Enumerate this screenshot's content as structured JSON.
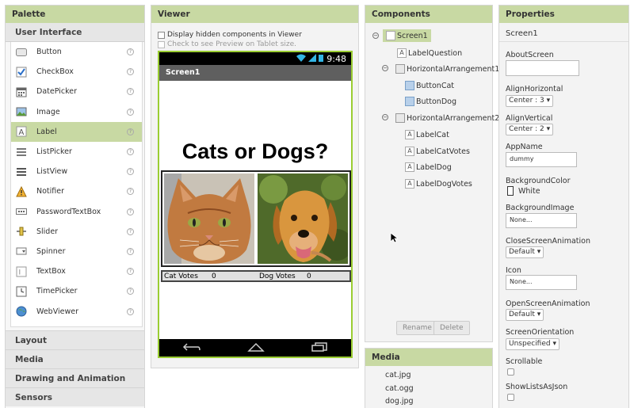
{
  "palette": {
    "title": "Palette",
    "category": "User Interface",
    "items": [
      {
        "label": "Button",
        "icon": "button-icon"
      },
      {
        "label": "CheckBox",
        "icon": "checkbox-icon"
      },
      {
        "label": "DatePicker",
        "icon": "calendar-icon"
      },
      {
        "label": "Image",
        "icon": "image-icon"
      },
      {
        "label": "Label",
        "icon": "label-icon"
      },
      {
        "label": "ListPicker",
        "icon": "listpicker-icon"
      },
      {
        "label": "ListView",
        "icon": "listview-icon"
      },
      {
        "label": "Notifier",
        "icon": "warning-icon"
      },
      {
        "label": "PasswordTextBox",
        "icon": "password-icon"
      },
      {
        "label": "Slider",
        "icon": "slider-icon"
      },
      {
        "label": "Spinner",
        "icon": "spinner-icon"
      },
      {
        "label": "TextBox",
        "icon": "textbox-icon"
      },
      {
        "label": "TimePicker",
        "icon": "clock-icon"
      },
      {
        "label": "WebViewer",
        "icon": "globe-icon"
      }
    ],
    "help_glyph": "?",
    "other_categories": [
      "Layout",
      "Media",
      "Drawing and Animation",
      "Sensors"
    ]
  },
  "viewer": {
    "title": "Viewer",
    "show_hidden": "Display hidden components in Viewer",
    "tablet_preview": "Check to see Preview on Tablet size.",
    "phone": {
      "time": "9:48",
      "screen_title": "Screen1",
      "question": "Cats or Dogs?",
      "cat_votes_label": "Cat Votes",
      "cat_votes": "0",
      "dog_votes_label": "Dog Votes",
      "dog_votes": "0"
    }
  },
  "components": {
    "title": "Components",
    "tree": [
      {
        "label": "Screen1",
        "icon": "screen-icon"
      },
      {
        "label": "LabelQuestion",
        "icon": "label-icon"
      },
      {
        "label": "HorizontalArrangement1",
        "icon": "arrangement-icon"
      },
      {
        "label": "ButtonCat",
        "icon": "button-icon"
      },
      {
        "label": "ButtonDog",
        "icon": "button-icon"
      },
      {
        "label": "HorizontalArrangement2",
        "icon": "arrangement-icon"
      },
      {
        "label": "LabelCat",
        "icon": "label-icon"
      },
      {
        "label": "LabelCatVotes",
        "icon": "label-icon"
      },
      {
        "label": "LabelDog",
        "icon": "label-icon"
      },
      {
        "label": "LabelDogVotes",
        "icon": "label-icon"
      }
    ],
    "rename": "Rename",
    "delete": "Delete"
  },
  "media": {
    "title": "Media",
    "files": [
      "cat.jpg",
      "cat.ogg",
      "dog.jpg"
    ]
  },
  "properties": {
    "title": "Properties",
    "screen": "Screen1",
    "about_label": "AboutScreen",
    "about_value": "",
    "align_h_label": "AlignHorizontal",
    "align_h_value": "Center : 3",
    "align_v_label": "AlignVertical",
    "align_v_value": "Center : 2",
    "appname_label": "AppName",
    "appname_value": "dummy",
    "bgcolor_label": "BackgroundColor",
    "bgcolor_value": "White",
    "bgimage_label": "BackgroundImage",
    "bgimage_value": "None...",
    "close_anim_label": "CloseScreenAnimation",
    "close_anim_value": "Default",
    "icon_label": "Icon",
    "icon_value": "None...",
    "open_anim_label": "OpenScreenAnimation",
    "open_anim_value": "Default",
    "orientation_label": "ScreenOrientation",
    "orientation_value": "Unspecified",
    "scrollable_label": "Scrollable",
    "showlists_label": "ShowListsAsJson"
  },
  "colors": {
    "header_green": "#c8d9a3",
    "phone_border": "#9acd32",
    "titlebar": "#5f5f5f"
  }
}
